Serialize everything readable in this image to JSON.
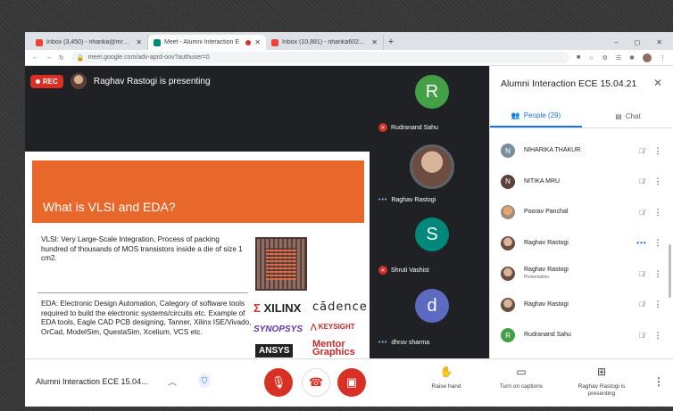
{
  "browser": {
    "tabs": [
      {
        "label": "Inbox (3,450) - nharika@mru.ac",
        "favicon_color": "#ea4335",
        "active": false
      },
      {
        "label": "Meet - Alumni Interaction E",
        "favicon_color": "#00897b",
        "active": true
      },
      {
        "label": "Inbox (10,881) - nharika6023@g",
        "favicon_color": "#ea4335",
        "active": false
      }
    ],
    "new_tab_label": "+",
    "window_controls": [
      "–",
      "◻",
      "✕"
    ],
    "url": "meet.google.com/adv-aprd-oov?authuser=0"
  },
  "meet": {
    "rec_label": "REC",
    "presenting_text": "Raghav Rastogi is presenting",
    "slide": {
      "title": "What is VLSI and EDA?",
      "para1": "VLSI: Very Large-Scale Integration, Process of packing hundred of thousands of MOS transistors inside a die of size 1 cm2.",
      "para2": "EDA: Electronic Design Automation, Category of software tools required to build the electronic systems/circuits etc. Example of EDA tools, Eagle CAD PCB designing, Tanner, Xilinx ISE/Vivado, OrCad, ModelSim, QuestaSim, Xcelium, VCS etc.",
      "logos": {
        "xilinx": "XILINX",
        "cadence": "cādence",
        "synopsys": "SYNOPSYS",
        "keysight": "KEYSIGHT",
        "ansys": "ANSYS",
        "mentor": "Mentor Graphics"
      }
    },
    "tiles": [
      {
        "initial": "R",
        "name": "Rudranand Sahu",
        "color": "#43a047",
        "status": "muted"
      },
      {
        "initial": "",
        "name": "Raghav Rastogi",
        "color": "#6d4c41",
        "status": "speaking"
      },
      {
        "initial": "S",
        "name": "Shruti Vashist",
        "color": "#00897b",
        "status": "muted"
      },
      {
        "initial": "d",
        "name": "dhruv sharma",
        "color": "#5c6bc0",
        "status": "speaking"
      }
    ]
  },
  "panel": {
    "title": "Alumni Interaction ECE 15.04.21",
    "people_tab": "People (29)",
    "chat_tab": "Chat",
    "participants": [
      {
        "initial": "N",
        "name": "NIHARIKA THAKUR",
        "sub": "",
        "color": "#78909c",
        "mic": "muted"
      },
      {
        "initial": "N",
        "name": "NITIKA MRU",
        "sub": "",
        "color": "#5d4037",
        "mic": "muted"
      },
      {
        "initial": "",
        "name": "Poorav Panchal",
        "sub": "",
        "color": "#a1887f",
        "mic": "muted"
      },
      {
        "initial": "",
        "name": "Raghav Rastogi",
        "sub": "",
        "color": "#6d4c41",
        "mic": "speaking"
      },
      {
        "initial": "",
        "name": "Raghav Rastogi",
        "sub": "Presentation",
        "color": "#6d4c41",
        "mic": "muted"
      },
      {
        "initial": "",
        "name": "Raghav Rastogi",
        "sub": "",
        "color": "#6d4c41",
        "mic": "muted"
      },
      {
        "initial": "R",
        "name": "Rudranand Sahu",
        "sub": "",
        "color": "#43a047",
        "mic": "muted"
      }
    ]
  },
  "bottom": {
    "meeting_name": "Alumni Interaction ECE 15.04...",
    "raise_hand": "Raise hand",
    "captions": "Turn on captions",
    "presenting": "Raghav Rastogi is presenting"
  }
}
